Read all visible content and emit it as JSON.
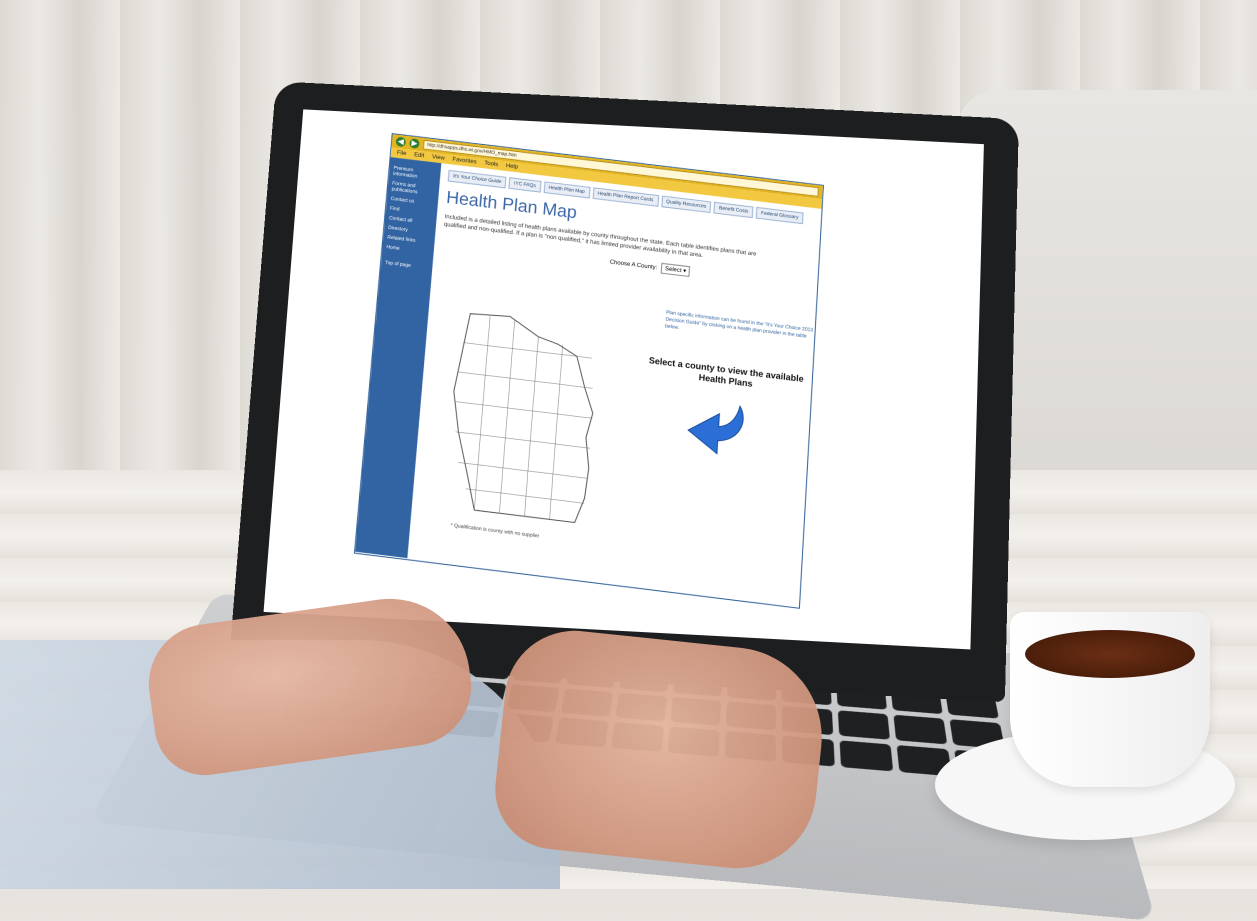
{
  "browser": {
    "address_bar_text": "http://dhsapps.dhs.wi.gov/HMO_map.htm",
    "menu": [
      "File",
      "Edit",
      "View",
      "Favorites",
      "Tools",
      "Help"
    ]
  },
  "left_nav": {
    "items": [
      "Premium information",
      "Forms and publications",
      "Contact us",
      "Find",
      "Contact all",
      "Directory",
      "Related links",
      "Home",
      "Top of page"
    ]
  },
  "tabs": [
    "It's Your Choice Guide",
    "IYC FAQs",
    "Health Plan Map",
    "Health Plan Report Cards",
    "Quality Resources",
    "Benefit Costs",
    "Federal Glossary"
  ],
  "page": {
    "title": "Health Plan Map",
    "intro": "Included is a detailed listing of health plans available by county throughout the state. Each table identifies plans that are qualified and non-qualified. If a plan is \"non qualified,\" it has limited provider availability in that area.",
    "county_label": "Choose A County:",
    "county_selected": "Select",
    "info_note": "Plan specific information can be found in the \"It's Your Choice 2013 Decision Guide\" by clicking on a health plan provider in the table below.",
    "cta": "Select a county to view the available Health Plans",
    "footnote": "* Qualification is county with no supplier"
  },
  "icons": {
    "arrow": "curved-arrow-left-icon",
    "state_map": "wisconsin-county-map"
  },
  "colors": {
    "title_blue": "#3d67a8",
    "nav_blue": "#3264a3",
    "browser_chrome": "#e3b51e",
    "arrow_blue": "#2b6fd6"
  }
}
